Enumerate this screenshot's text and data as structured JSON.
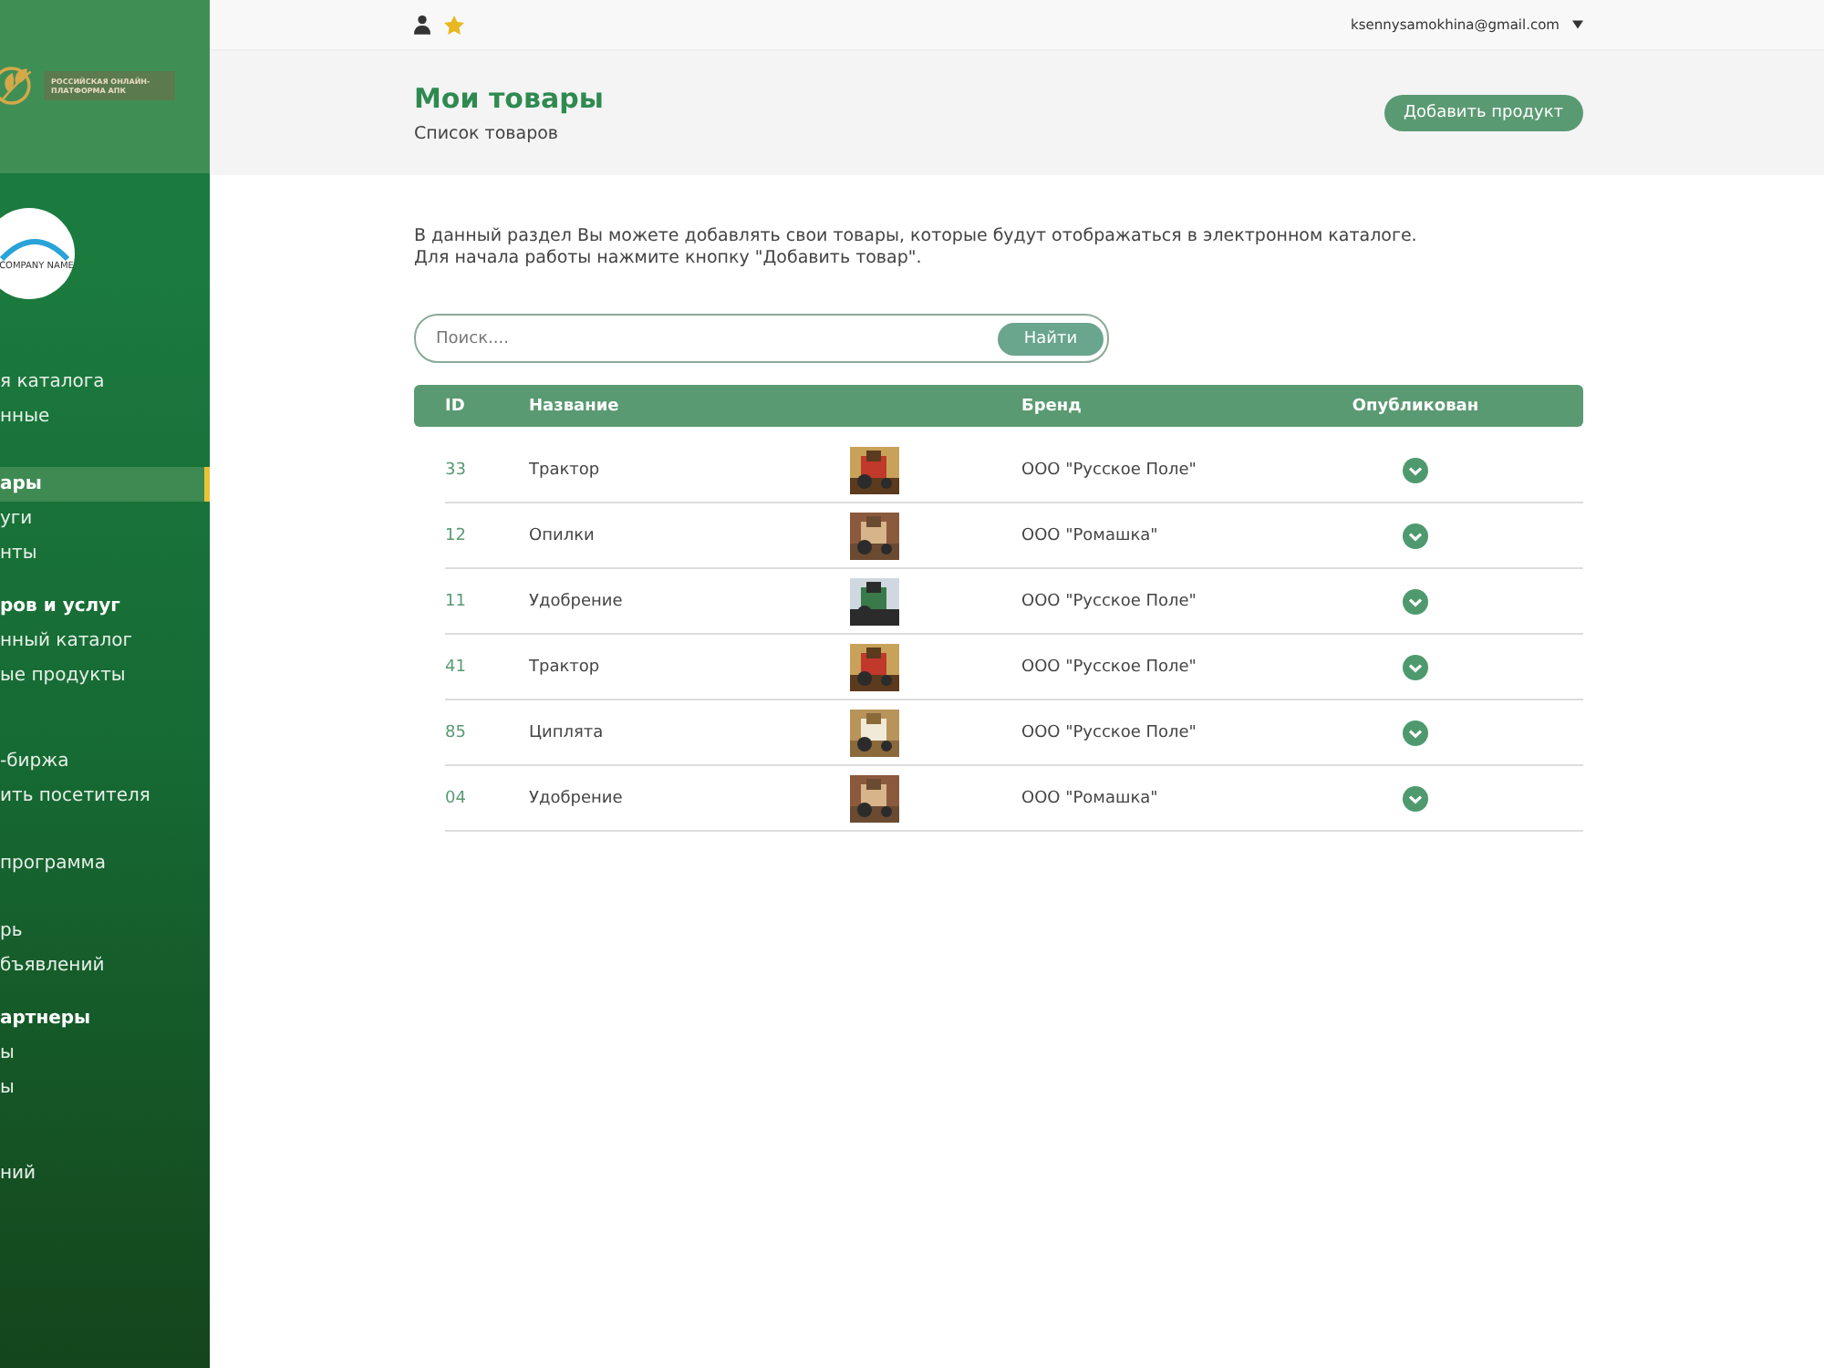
{
  "sidebar": {
    "logo_text": "РОССИЙСКАЯ ОНЛАЙН-ПЛАТФОРМА АПК",
    "company_name": "COMPANY NAME",
    "groups": [
      {
        "items": [
          {
            "label": "я каталога",
            "selected": false
          },
          {
            "label": "нные",
            "selected": false
          }
        ]
      },
      {
        "items": [
          {
            "label": "ары",
            "selected": true
          },
          {
            "label": "уги",
            "selected": false
          },
          {
            "label": "нты",
            "selected": false
          }
        ]
      },
      {
        "title": "ров и услуг",
        "items": [
          {
            "label": "нный каталог",
            "selected": false
          },
          {
            "label": "ые продукты",
            "selected": false
          }
        ]
      },
      {
        "items": [
          {
            "label": "-биржа",
            "selected": false
          },
          {
            "label": "ить посетителя",
            "selected": false
          }
        ]
      },
      {
        "items": [
          {
            "label": " программа",
            "selected": false
          }
        ]
      },
      {
        "items": [
          {
            "label": "рь",
            "selected": false
          },
          {
            "label": "бъявлений",
            "selected": false
          }
        ]
      },
      {
        "title": "артнеры",
        "items": [
          {
            "label": "ы",
            "selected": false
          },
          {
            "label": "ы",
            "selected": false
          }
        ]
      },
      {
        "items": [
          {
            "label": "ний",
            "selected": false
          }
        ]
      }
    ]
  },
  "topbar": {
    "email": "ksennysamokhina@gmail.com"
  },
  "header": {
    "title": "Мои товары",
    "subtitle": "Список товаров",
    "button": "Добавить продукт"
  },
  "intro": [
    "В данный раздел Вы можете добавлять свои товары, которые будут отображаться в электронном каталоге.",
    "Для начала работы нажмите кнопку \"Добавить товар\"."
  ],
  "search": {
    "placeholder": "Поиск....",
    "button": "Найти"
  },
  "table": {
    "columns": [
      "ID",
      "Название",
      "Бренд",
      "Опубликован"
    ],
    "rows": [
      {
        "id": "33",
        "name": "Трактор",
        "brand": "ООО \"Русское Поле\"",
        "published": true
      },
      {
        "id": "12",
        "name": "Опилки",
        "brand": "ООО \"Ромашка\"",
        "published": true
      },
      {
        "id": "11",
        "name": "Удобрение",
        "brand": "ООО \"Русское Поле\"",
        "published": true
      },
      {
        "id": "41",
        "name": "Трактор",
        "brand": "ООО \"Русское Поле\"",
        "published": true
      },
      {
        "id": "85",
        "name": "Циплята",
        "brand": "ООО \"Русское Поле\"",
        "published": true
      },
      {
        "id": "04",
        "name": "Удобрение",
        "brand": "ООО \"Ромашка\"",
        "published": true
      }
    ]
  }
}
